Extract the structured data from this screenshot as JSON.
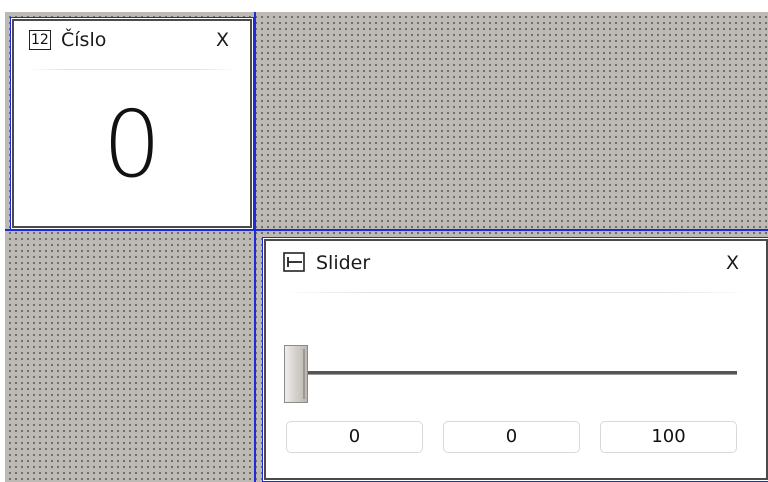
{
  "number_widget": {
    "icon_text": "12",
    "title": "Číslo",
    "close_label": "X",
    "value": "0"
  },
  "slider_widget": {
    "icon": "slider-icon",
    "title": "Slider",
    "close_label": "X",
    "value_fraction": 0.0,
    "min_value": "0",
    "current_value": "0",
    "max_value": "100"
  },
  "colors": {
    "grid_line": "#1f2bd6",
    "canvas_background": "#bdbab5"
  }
}
